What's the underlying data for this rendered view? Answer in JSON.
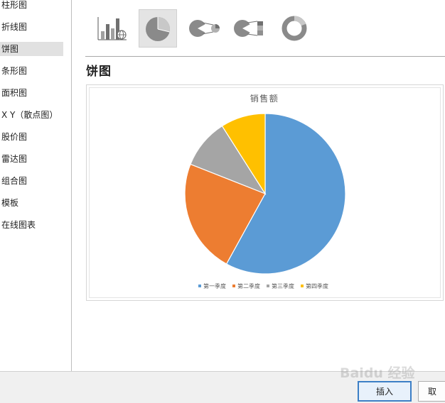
{
  "sidebar": {
    "items": [
      {
        "label": "柱形图"
      },
      {
        "label": "折线图"
      },
      {
        "label": "饼图",
        "selected": true
      },
      {
        "label": "条形图"
      },
      {
        "label": "面积图"
      },
      {
        "label": "X Y（散点图）"
      },
      {
        "label": "股价图"
      },
      {
        "label": "雷达图"
      },
      {
        "label": "组合图"
      },
      {
        "label": "模板"
      },
      {
        "label": "在线图表"
      }
    ]
  },
  "subtypes": [
    {
      "icon": "bar-globe-icon"
    },
    {
      "icon": "pie-icon",
      "selected": true
    },
    {
      "icon": "pie-of-pie-icon"
    },
    {
      "icon": "bar-of-pie-icon"
    },
    {
      "icon": "doughnut-icon"
    }
  ],
  "section_title": "饼图",
  "chart_data": {
    "type": "pie",
    "title": "销售额",
    "categories": [
      "第一季度",
      "第二季度",
      "第三季度",
      "第四季度"
    ],
    "values": [
      58,
      23,
      10,
      9
    ],
    "colors": [
      "#5b9bd5",
      "#ed7d31",
      "#a5a5a5",
      "#ffc000"
    ],
    "legend": "bottom"
  },
  "buttons": {
    "insert_label": "插入",
    "cancel_label": "取"
  },
  "watermark": "Baidu 经验"
}
